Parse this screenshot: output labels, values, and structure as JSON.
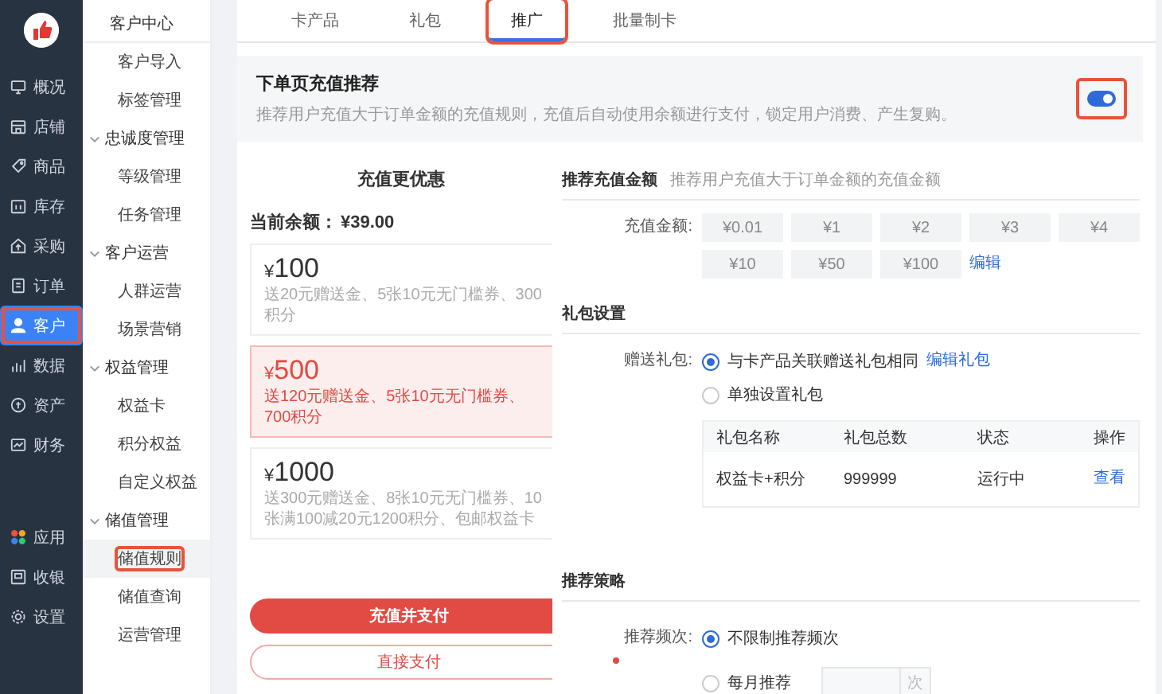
{
  "nav": {
    "items": [
      {
        "label": "概况",
        "selected": false,
        "highlighted": false
      },
      {
        "label": "店铺",
        "selected": false,
        "highlighted": false
      },
      {
        "label": "商品",
        "selected": false,
        "highlighted": false
      },
      {
        "label": "库存",
        "selected": false,
        "highlighted": false
      },
      {
        "label": "采购",
        "selected": false,
        "highlighted": false
      },
      {
        "label": "订单",
        "selected": false,
        "highlighted": false
      },
      {
        "label": "客户",
        "selected": true,
        "highlighted": true
      },
      {
        "label": "数据",
        "selected": false,
        "highlighted": false
      },
      {
        "label": "资产",
        "selected": false,
        "highlighted": false
      },
      {
        "label": "财务",
        "selected": false,
        "highlighted": false
      }
    ],
    "bottom_items": [
      {
        "label": "应用",
        "selected": false,
        "highlighted": false
      },
      {
        "label": "收银",
        "selected": false,
        "highlighted": false
      },
      {
        "label": "设置",
        "selected": false,
        "highlighted": false
      }
    ]
  },
  "submenu": {
    "title": "客户中心",
    "groups": [
      {
        "children": [
          {
            "label": "客户导入",
            "selected": false,
            "highlighted": false
          },
          {
            "label": "标签管理",
            "selected": false,
            "highlighted": false
          }
        ]
      },
      {
        "label": "忠诚度管理",
        "expanded": true,
        "children": [
          {
            "label": "等级管理",
            "selected": false,
            "highlighted": false
          },
          {
            "label": "任务管理",
            "selected": false,
            "highlighted": false
          }
        ]
      },
      {
        "label": "客户运营",
        "expanded": true,
        "children": [
          {
            "label": "人群运营",
            "selected": false,
            "highlighted": false
          },
          {
            "label": "场景营销",
            "selected": false,
            "highlighted": false
          }
        ]
      },
      {
        "label": "权益管理",
        "expanded": true,
        "children": [
          {
            "label": "权益卡",
            "selected": false,
            "highlighted": false
          },
          {
            "label": "积分权益",
            "selected": false,
            "highlighted": false
          },
          {
            "label": "自定义权益",
            "selected": false,
            "highlighted": false
          }
        ]
      },
      {
        "label": "储值管理",
        "expanded": true,
        "children": [
          {
            "label": "储值规则",
            "selected": true,
            "highlighted": true
          },
          {
            "label": "储值查询",
            "selected": false,
            "highlighted": false
          },
          {
            "label": "运营管理",
            "selected": false,
            "highlighted": false
          }
        ]
      }
    ]
  },
  "tabs": [
    {
      "label": "卡产品",
      "selected": false,
      "highlighted": false
    },
    {
      "label": "礼包",
      "selected": false,
      "highlighted": false
    },
    {
      "label": "推广",
      "selected": true,
      "highlighted": true
    },
    {
      "label": "批量制卡",
      "selected": false,
      "highlighted": false
    }
  ],
  "promo": {
    "title": "下单页充值推荐",
    "description": "推荐用户充值大于订单金额的充值规则，充值后自动使用余额进行支付，锁定用户消费、产生复购。",
    "on": true,
    "highlighted": true
  },
  "preview": {
    "title": "充值更优惠",
    "balance_label": "当前余额：",
    "balance_value": "¥39.00",
    "options": [
      {
        "currency": "¥",
        "amount": "100",
        "description": "送20元赠送金、5张10元无门槛券、300积分",
        "selected": false
      },
      {
        "currency": "¥",
        "amount": "500",
        "description": "送120元赠送金、5张10元无门槛券、700积分",
        "selected": true
      },
      {
        "currency": "¥",
        "amount": "1000",
        "description": "送300元赠送金、8张10元无门槛券、10张满100减20元1200积分、包邮权益卡",
        "selected": false
      }
    ],
    "primary_button": "充值并支付",
    "secondary_button": "直接支付"
  },
  "amount_section": {
    "title": "推荐充值金额",
    "hint": "推荐用户充值大于订单金额的充值金额",
    "label": "充值金额:",
    "amounts": [
      "¥0.01",
      "¥1",
      "¥2",
      "¥3",
      "¥4",
      "¥10",
      "¥50",
      "¥100"
    ],
    "edit_link": "编辑"
  },
  "gift_section": {
    "title": "礼包设置",
    "label": "赠送礼包:",
    "options": [
      {
        "label": "与卡产品关联赠送礼包相同",
        "selected": true,
        "link": "编辑礼包"
      },
      {
        "label": "单独设置礼包",
        "selected": false
      }
    ],
    "table": {
      "columns": [
        "礼包名称",
        "礼包总数",
        "状态",
        "操作"
      ],
      "rows": [
        {
          "cells": [
            "权益卡+积分",
            "999999",
            "运行中"
          ],
          "action": "查看"
        }
      ]
    }
  },
  "strategy": {
    "title": "推荐策略",
    "label": "推荐频次:",
    "required": true,
    "options": [
      {
        "kind": "plain",
        "label": "不限制推荐频次",
        "selected": true
      },
      {
        "kind": "count",
        "label": "每月推荐",
        "selected": false,
        "unit": "次"
      }
    ]
  }
}
